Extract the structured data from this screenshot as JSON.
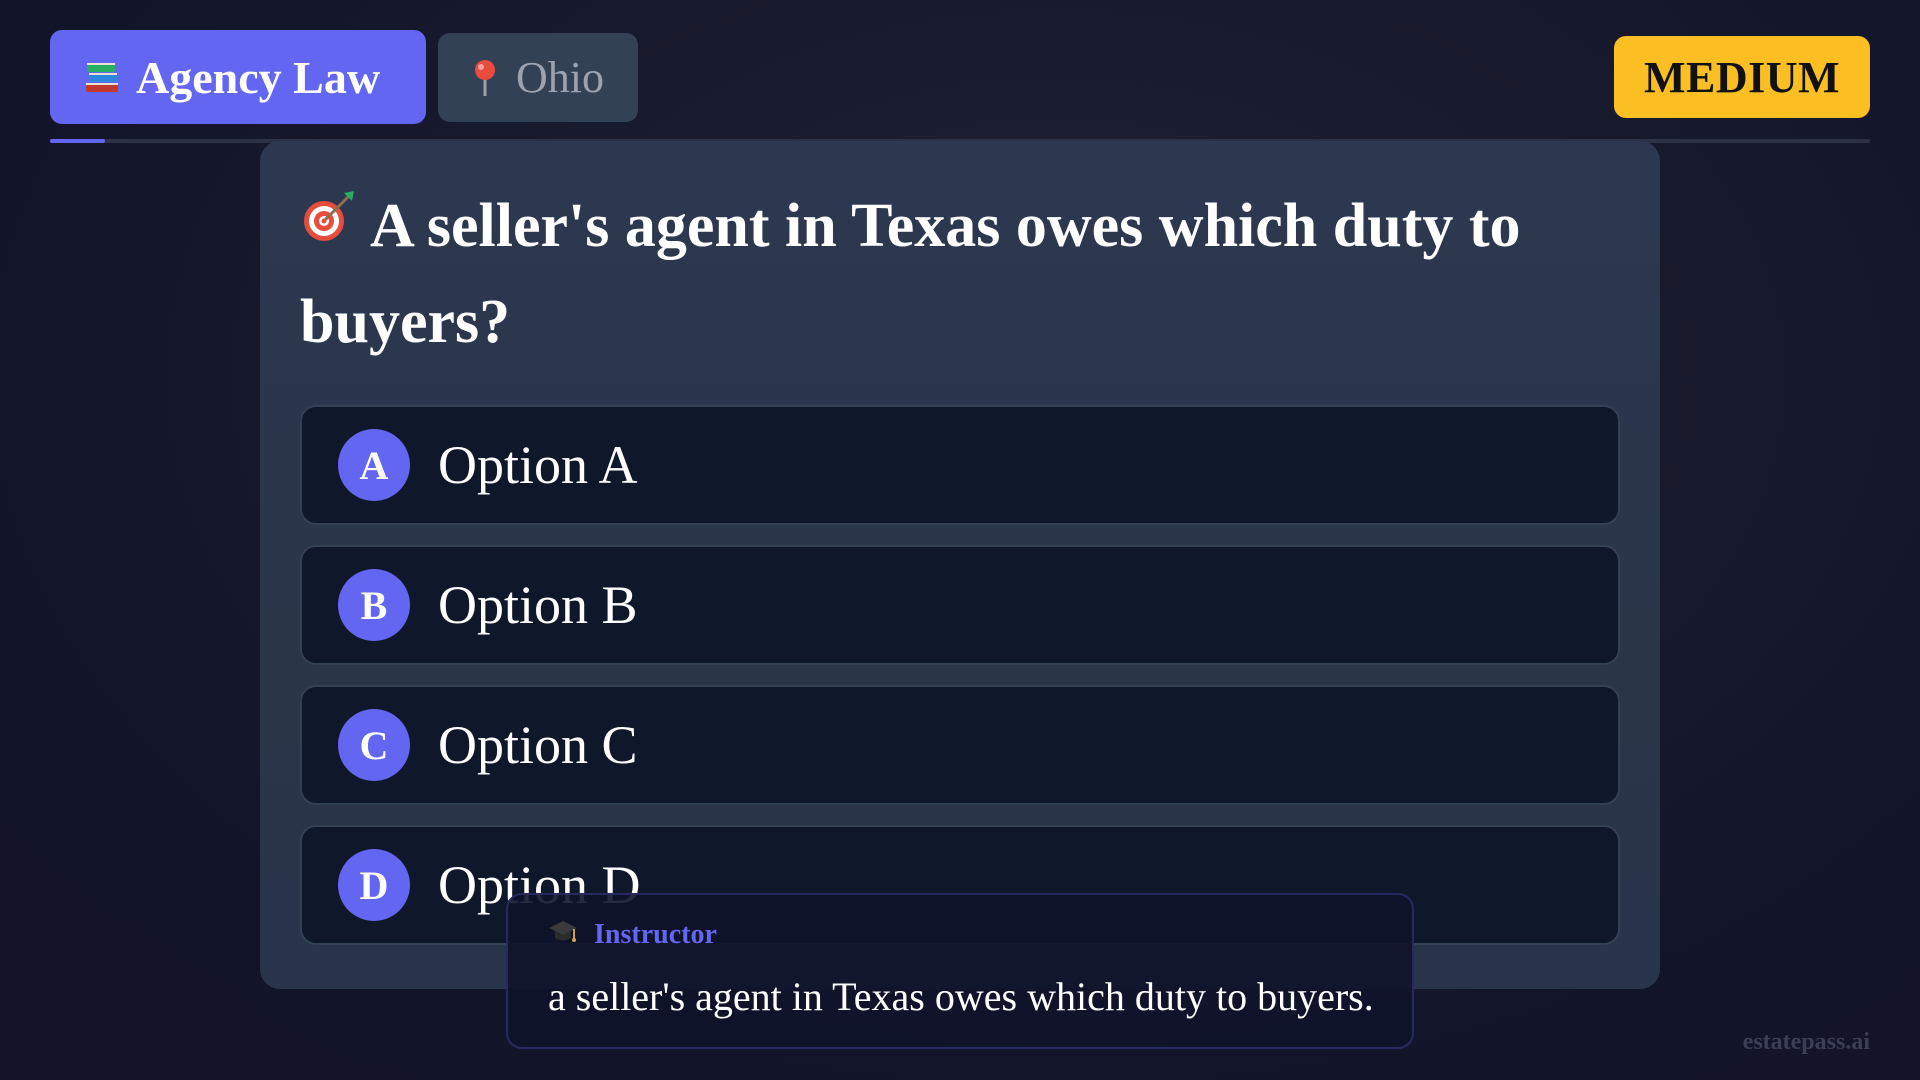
{
  "header": {
    "category": {
      "icon": "books-icon",
      "label": "Agency Law"
    },
    "state": {
      "icon": "pushpin-icon",
      "label": "Ohio"
    },
    "difficulty": "MEDIUM"
  },
  "progress": {
    "fraction": 0.03
  },
  "question": {
    "icon": "target-icon",
    "text": "A seller's agent in Texas owes which duty to buyers?",
    "options": [
      {
        "letter": "A",
        "text": "Option A"
      },
      {
        "letter": "B",
        "text": "Option B"
      },
      {
        "letter": "C",
        "text": "Option C"
      },
      {
        "letter": "D",
        "text": "Option D"
      }
    ]
  },
  "instructor": {
    "icon": "graduation-cap-icon",
    "label": "Instructor",
    "message": "a seller's agent in Texas owes which duty to buyers."
  },
  "watermark": "estatepass.ai",
  "colors": {
    "accent": "#6366f1",
    "difficulty": "#fbbf24",
    "card": "#2a3548",
    "option_bg": "#0f172a"
  }
}
